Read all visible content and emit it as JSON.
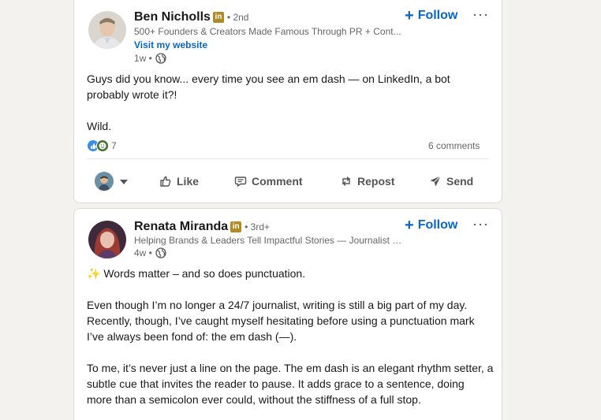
{
  "posts": [
    {
      "author": "Ben Nicholls",
      "degree": "• 2nd",
      "headline": "500+ Founders & Creators Made Famous Through PR + Cont...",
      "website": "Visit my website",
      "time": "1w •",
      "follow_label": "Follow",
      "body": [
        "Guys did you know... every time you see an em dash — on LinkedIn, a bot",
        "probably wrote it?!",
        "",
        "Wild."
      ],
      "reaction_count": "7",
      "comments": "6 comments",
      "actions": {
        "like": "Like",
        "comment": "Comment",
        "repost": "Repost",
        "send": "Send"
      }
    },
    {
      "author": "Renata Miranda",
      "degree": "• 3rd+",
      "headline": "Helping Brands & Leaders Tell Impactful Stories — Journalist |...",
      "time": "4w •",
      "follow_label": "Follow",
      "body": [
        "✨ Words matter – and so does punctuation.",
        "",
        "Even though I’m no longer a 24/7 journalist, writing is still a big part of my day.",
        "Recently, though, I’ve caught myself hesitating before using a punctuation mark",
        "I’ve always been fond of: the em dash (—).",
        "",
        "To me, it’s never just a line on the page. The em dash is an elegant rhythm setter, a",
        "subtle cue that invites the reader to pause. It adds grace to a sentence, doing",
        "more than a semicolon ever could, without the stiffness of a full stop."
      ]
    }
  ],
  "icons": {
    "linkedin_badge": "in",
    "more": "···",
    "globe": "globe-icon"
  },
  "colors": {
    "accent": "#0a66c2",
    "premium_badge": "#b18a27",
    "background": "#f4f2ee"
  }
}
